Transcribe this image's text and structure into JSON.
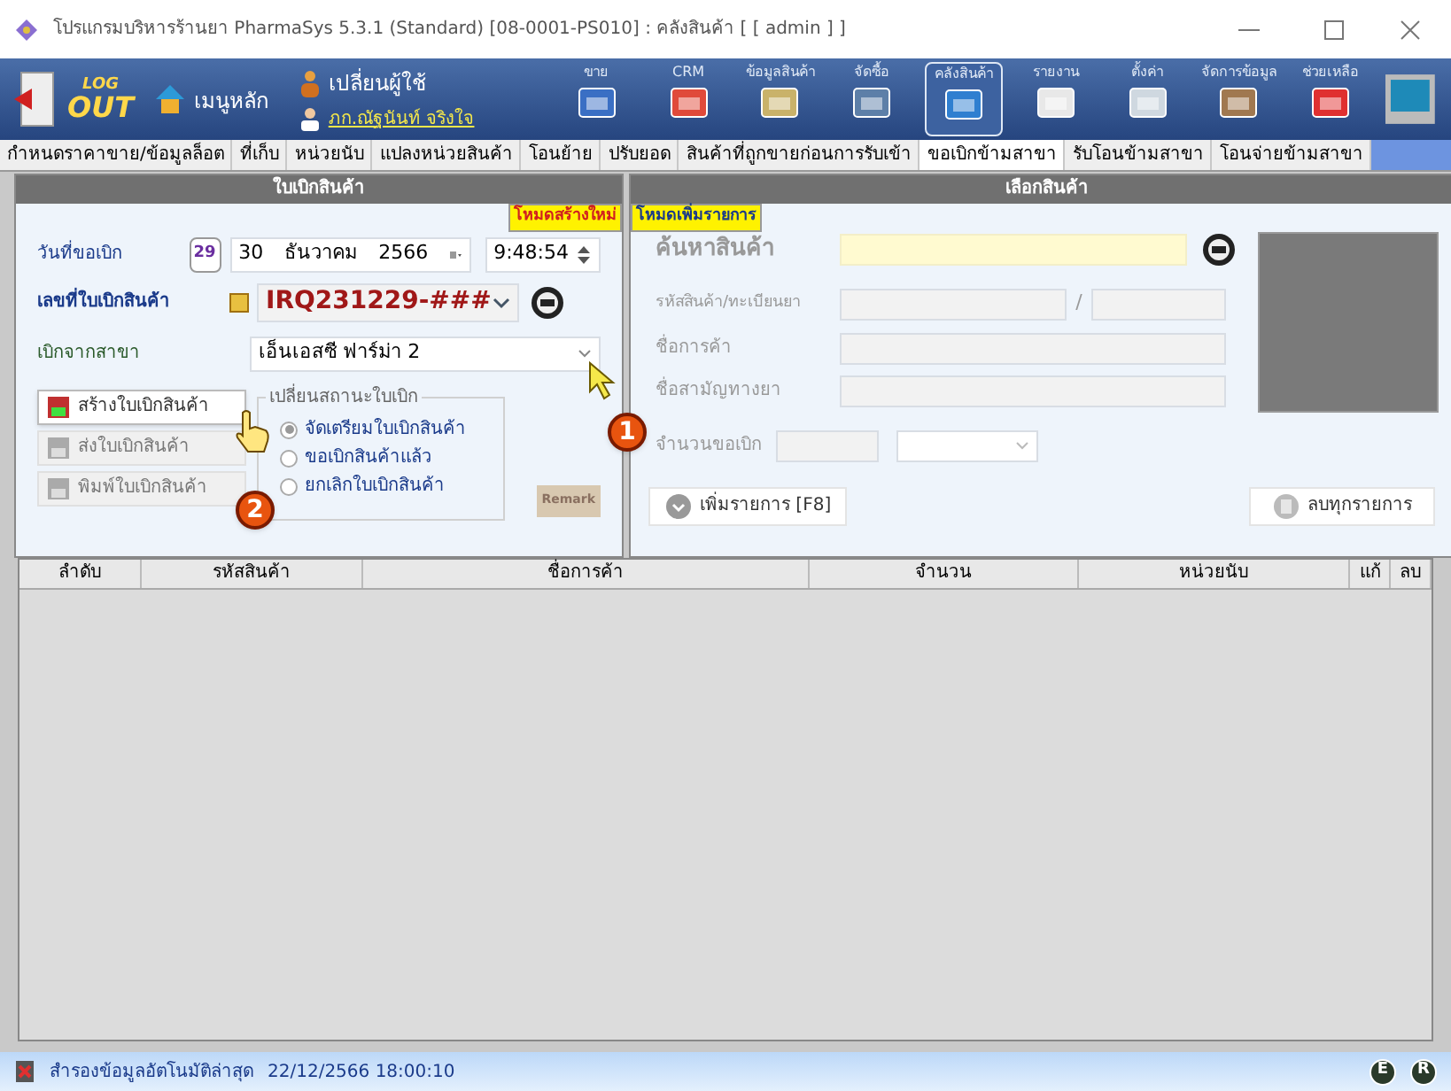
{
  "window": {
    "title": "โปรแกรมบริหารร้านยา PharmaSys 5.3.1 (Standard) [08-0001-PS010] : คลังสินค้า  [ [ admin ] ]"
  },
  "toolbar": {
    "logout_top": "LOG",
    "logout_bottom": "OUT",
    "home": "เมนูหลัก",
    "change_user": "เปลี่ยนผู้ใช้",
    "user": "ภก.ณัฐนันท์ จริงใจ",
    "modules": [
      {
        "label": "ขาย",
        "selected": false
      },
      {
        "label": "CRM",
        "selected": false
      },
      {
        "label": "ข้อมูลสินค้า",
        "selected": false
      },
      {
        "label": "จัดซื้อ",
        "selected": false
      },
      {
        "label": "คลังสินค้า",
        "selected": true
      },
      {
        "label": "รายงาน",
        "selected": false
      },
      {
        "label": "ตั้งค่า",
        "selected": false
      },
      {
        "label": "จัดการข้อมูล",
        "selected": false
      },
      {
        "label": "ช่วยเหลือ",
        "selected": false
      }
    ]
  },
  "tabs": [
    {
      "label": "กำหนดราคาขาย/ข้อมูลล็อต",
      "selected": false
    },
    {
      "label": "ที่เก็บ",
      "selected": false
    },
    {
      "label": "หน่วยนับ",
      "selected": false
    },
    {
      "label": "แปลงหน่วยสินค้า",
      "selected": false
    },
    {
      "label": "โอนย้าย",
      "selected": false
    },
    {
      "label": "ปรับยอด",
      "selected": false
    },
    {
      "label": "สินค้าที่ถูกขายก่อนการรับเข้า",
      "selected": false
    },
    {
      "label": "ขอเบิกข้ามสาขา",
      "selected": true
    },
    {
      "label": "รับโอนข้ามสาขา",
      "selected": false
    },
    {
      "label": "โอนจ่ายข้ามสาขา",
      "selected": false
    }
  ],
  "requisition": {
    "title": "ใบเบิกสินค้า",
    "mode": "โหมดสร้างใหม่",
    "date_label": "วันที่ขอเบิก",
    "calendar_day": "29",
    "date_day": "30",
    "date_month": "ธันวาคม",
    "date_year": "2566",
    "time": "9:48:54",
    "number_label": "เลขที่ใบเบิกสินค้า",
    "number": "IRQ231229-###",
    "branch_label": "เบิกจากสาขา",
    "branch": "เอ็นเอสซี ฟาร์ม่า 2",
    "buttons": [
      {
        "label": "สร้างใบเบิกสินค้า",
        "disabled": false
      },
      {
        "label": "ส่งใบเบิกสินค้า",
        "disabled": true
      },
      {
        "label": "พิมพ์ใบเบิกสินค้า",
        "disabled": true
      }
    ],
    "status_title": "เปลี่ยนสถานะใบเบิก",
    "status_options": [
      {
        "label": "จัดเตรียมใบเบิกสินค้า",
        "selected": true
      },
      {
        "label": "ขอเบิกสินค้าแล้ว",
        "selected": false
      },
      {
        "label": "ยกเลิกใบเบิกสินค้า",
        "selected": false
      }
    ],
    "remark": "Remark"
  },
  "product": {
    "title": "เลือกสินค้า",
    "mode": "โหมดเพิ่มรายการ",
    "search_label": "ค้นหาสินค้า",
    "code_label": "รหัสสินค้า/ทะเบียนยา",
    "separator": "/",
    "trade_label": "ชื่อการค้า",
    "generic_label": "ชื่อสามัญทางยา",
    "quantity_label": "จำนวนขอเบิก",
    "add_button": "เพิ่มรายการ [F8]",
    "clear_button": "ลบทุกรายการ"
  },
  "table": {
    "columns": [
      "ลำดับ",
      "รหัสสินค้า",
      "ชื่อการค้า",
      "จำนวน",
      "หน่วยนับ",
      "แก้",
      "ลบ"
    ]
  },
  "status_bar": {
    "text": "สำรองข้อมูลอัตโนมัติล่าสุด",
    "time": "22/12/2566 18:00:10",
    "badges": [
      "E",
      "R"
    ]
  },
  "callouts": [
    "1",
    "2"
  ]
}
